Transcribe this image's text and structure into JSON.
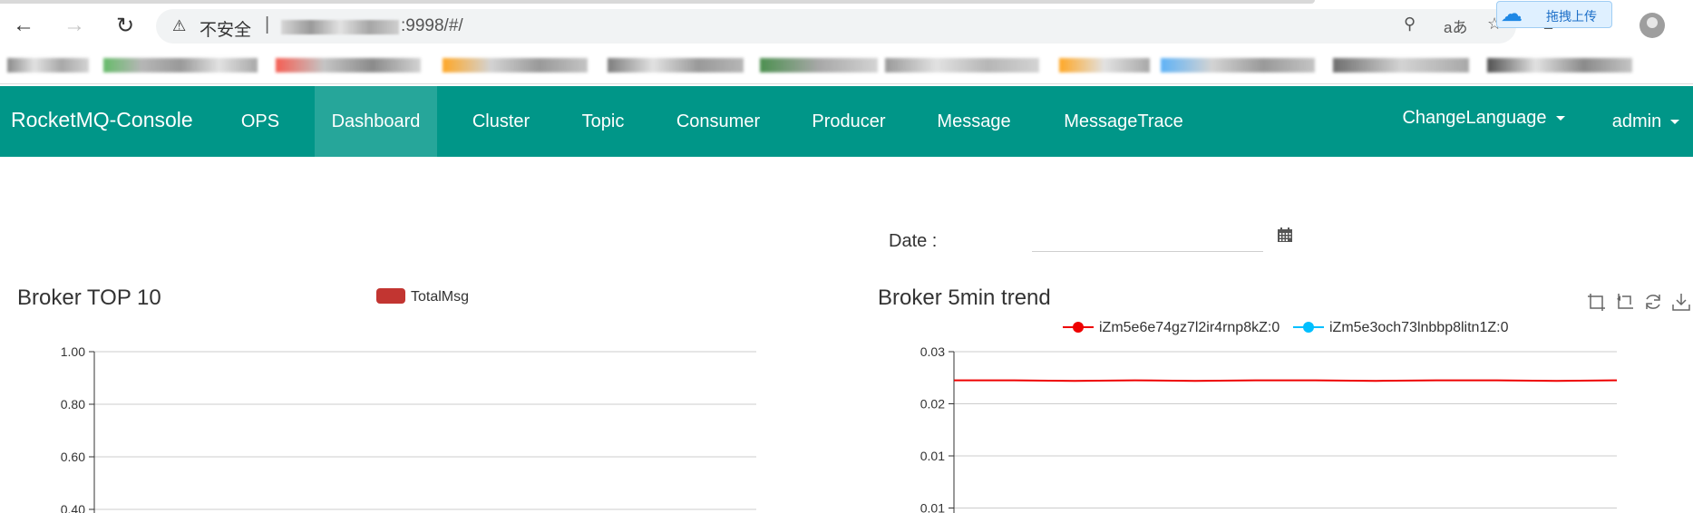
{
  "browser": {
    "security_label": "不安全",
    "separator": "|",
    "url_visible": ":9998/#/",
    "upload_badge": "拖拽上传"
  },
  "navbar": {
    "brand": "RocketMQ-Console",
    "items": [
      {
        "label": "OPS",
        "active": false
      },
      {
        "label": "Dashboard",
        "active": true
      },
      {
        "label": "Cluster",
        "active": false
      },
      {
        "label": "Topic",
        "active": false
      },
      {
        "label": "Consumer",
        "active": false
      },
      {
        "label": "Producer",
        "active": false
      },
      {
        "label": "Message",
        "active": false
      },
      {
        "label": "MessageTrace",
        "active": false
      }
    ],
    "change_language": "ChangeLanguage",
    "user": "admin",
    "color": "#009688",
    "active_color": "#26a69a"
  },
  "date_filter": {
    "label": "Date :",
    "value": ""
  },
  "chart_data": [
    {
      "type": "bar",
      "title": "Broker TOP 10",
      "legend": [
        "TotalMsg"
      ],
      "series": [
        {
          "name": "TotalMsg",
          "color": "#c23531",
          "values": []
        }
      ],
      "ylim": [
        0.4,
        1.0
      ],
      "y_ticks": [
        "1.00",
        "0.80",
        "0.60",
        "0.40"
      ],
      "grid": true
    },
    {
      "type": "line",
      "title": "Broker 5min trend",
      "legend": [
        "iZm5e6e74gz7l2ir4rnp8kZ:0",
        "iZm5e3och73lnbbp8litn1Z:0"
      ],
      "series": [
        {
          "name": "iZm5e6e74gz7l2ir4rnp8kZ:0",
          "color": "#ee0000",
          "values": [
            0.0245,
            0.0245,
            0.0244,
            0.0245,
            0.0244,
            0.0245,
            0.0245,
            0.0244,
            0.0245,
            0.0245,
            0.0244,
            0.0245
          ]
        },
        {
          "name": "iZm5e3och73lnbbp8litn1Z:0",
          "color": "#00bfff",
          "values": []
        }
      ],
      "ylim": [
        0.01,
        0.03
      ],
      "y_ticks": [
        "0.03",
        "0.02",
        "0.01",
        "0.01"
      ],
      "grid": true
    }
  ]
}
